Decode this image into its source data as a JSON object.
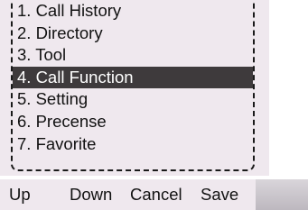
{
  "menu": {
    "items": [
      {
        "label": "1. Call History",
        "selected": false
      },
      {
        "label": "2. Directory",
        "selected": false
      },
      {
        "label": "3. Tool",
        "selected": false
      },
      {
        "label": "4. Call Function",
        "selected": true
      },
      {
        "label": "5. Setting",
        "selected": false
      },
      {
        "label": "6. Precense",
        "selected": false
      },
      {
        "label": "7. Favorite",
        "selected": false
      }
    ]
  },
  "softkeys": {
    "up": "Up",
    "down": "Down",
    "cancel": "Cancel",
    "save": "Save"
  },
  "colors": {
    "screen_background": "#efe8ee",
    "selection_background": "#3e3a3c",
    "selection_text": "#ffffff",
    "text": "#111111"
  }
}
